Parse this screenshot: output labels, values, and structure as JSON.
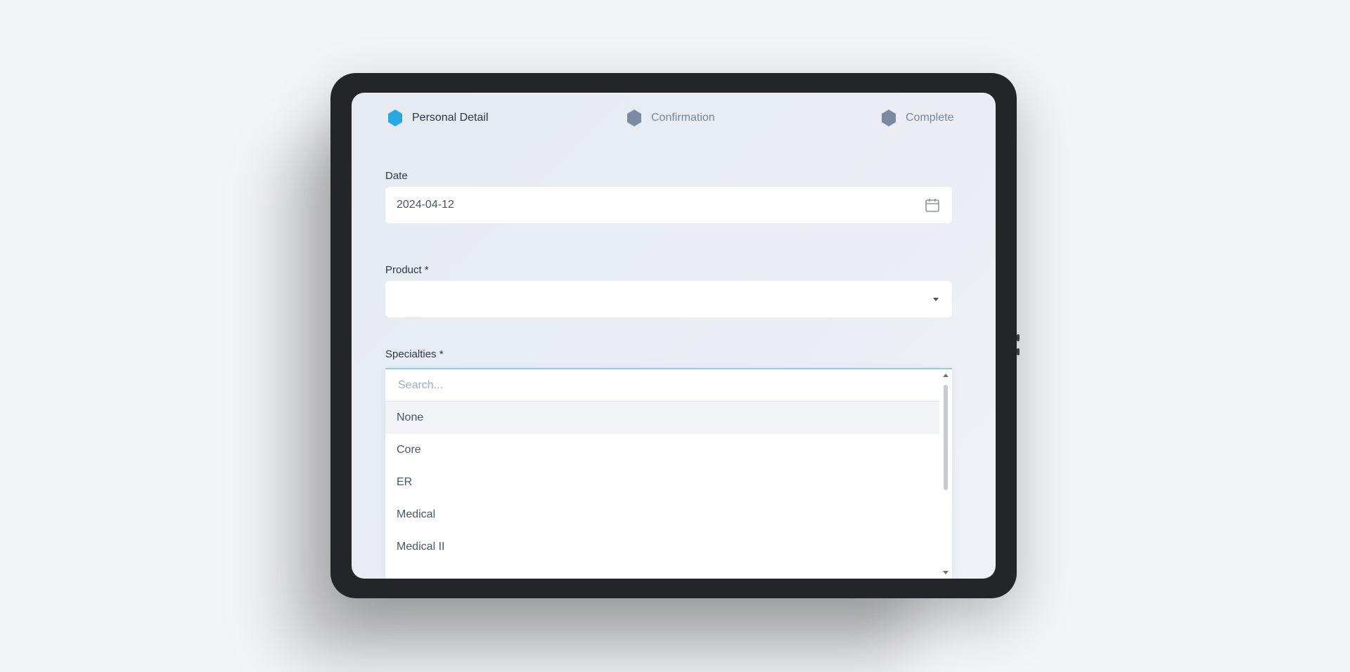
{
  "stepper": {
    "steps": [
      {
        "label": "Personal Detail",
        "state": "active",
        "color": "#29a8e0"
      },
      {
        "label": "Confirmation",
        "state": "inactive",
        "color": "#7b8aa3"
      },
      {
        "label": "Complete",
        "state": "inactive",
        "color": "#7b8aa3"
      }
    ]
  },
  "form": {
    "date": {
      "label": "Date",
      "value": "2024-04-12",
      "icon": "calendar-icon"
    },
    "product": {
      "label": "Product *",
      "value": "",
      "icon": "chevron-down-icon"
    },
    "specialties": {
      "label": "Specialties *",
      "search_placeholder": "Search...",
      "options": [
        "None",
        "Core",
        "ER",
        "Medical",
        "Medical II"
      ],
      "highlighted_index": 0
    }
  },
  "colors": {
    "accent": "#29a8e0",
    "focus_border": "#8ecdf0",
    "tablet_bezel": "#232528"
  }
}
